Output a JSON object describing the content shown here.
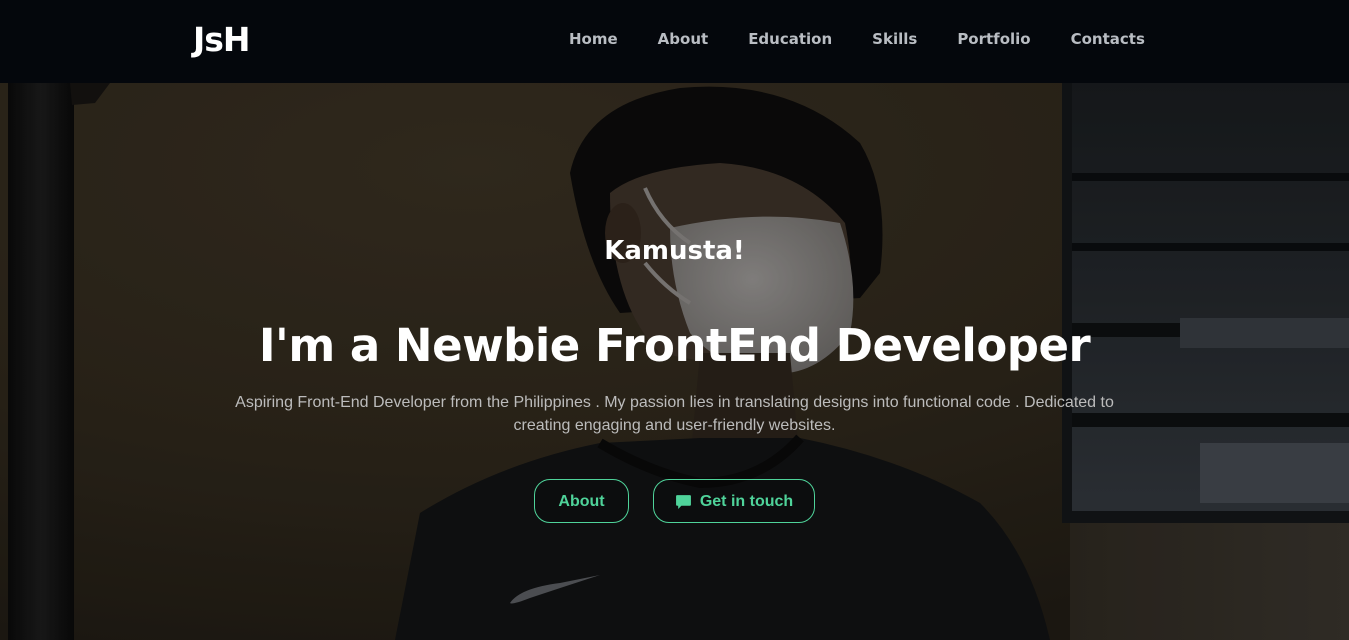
{
  "header": {
    "logo": "JsH",
    "nav": [
      {
        "label": "Home"
      },
      {
        "label": "About"
      },
      {
        "label": "Education"
      },
      {
        "label": "Skills"
      },
      {
        "label": "Portfolio"
      },
      {
        "label": "Contacts"
      }
    ]
  },
  "hero": {
    "greeting": "Kamusta!",
    "headline": "I'm a Newbie FrontEnd Developer",
    "description": "Aspiring Front-End Developer from the Philippines . My passion lies in translating designs into functional code . Dedicated to creating engaging and user-friendly websites.",
    "buttons": {
      "about": "About",
      "contact": "Get in touch"
    },
    "contact_icon": "chat-bubble-icon",
    "background_icon": "profile-photo"
  },
  "colors": {
    "accent": "#4fd39a",
    "navbar_bg": "#04070c",
    "nav_text": "#b9bdc3",
    "text": "#ffffff",
    "muted_text": "#bcbcbc"
  }
}
